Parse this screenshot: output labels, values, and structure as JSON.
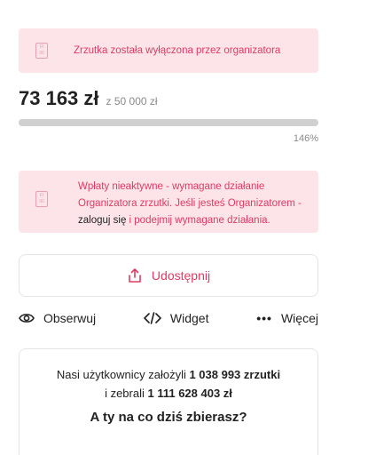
{
  "alert_disabled": {
    "icon_text": [
      "FI",
      "90"
    ],
    "text": "Zrzutka została wyłączona przez organizatora"
  },
  "amount": {
    "raised": "73 163 zł",
    "goal": "z 50 000 zł",
    "percent_label": "146%",
    "progress_fraction": 1.0
  },
  "alert_inactive": {
    "icon_text": [
      "FI",
      "90"
    ],
    "text_before": "Wpłaty nieaktywne - wymagane działanie Organizatora zrzutki. Jeśli jesteś Organizatorem - ",
    "login_link": "zaloguj się",
    "text_after": " i podejmij wymagane działania."
  },
  "share": {
    "label": "Udostępnij",
    "icon": "share-upload-icon"
  },
  "actions": {
    "observe": {
      "label": "Obserwuj",
      "icon": "eye-icon"
    },
    "widget": {
      "label": "Widget",
      "icon": "code-icon"
    },
    "more": {
      "label": "Więcej",
      "icon": "more-dots-icon"
    }
  },
  "stats": {
    "line1_prefix": "Nasi użytkownicy założyli ",
    "line1_bold": "1 038 993 zrzutki",
    "line2_prefix": "i zebrali ",
    "line2_bold": "1 111 628 403 zł",
    "question": "A ty na co dziś zbierasz?"
  },
  "colors": {
    "accent": "#e03a63",
    "alert_bg": "#fde4e9",
    "progress": "#d0d0d0"
  }
}
